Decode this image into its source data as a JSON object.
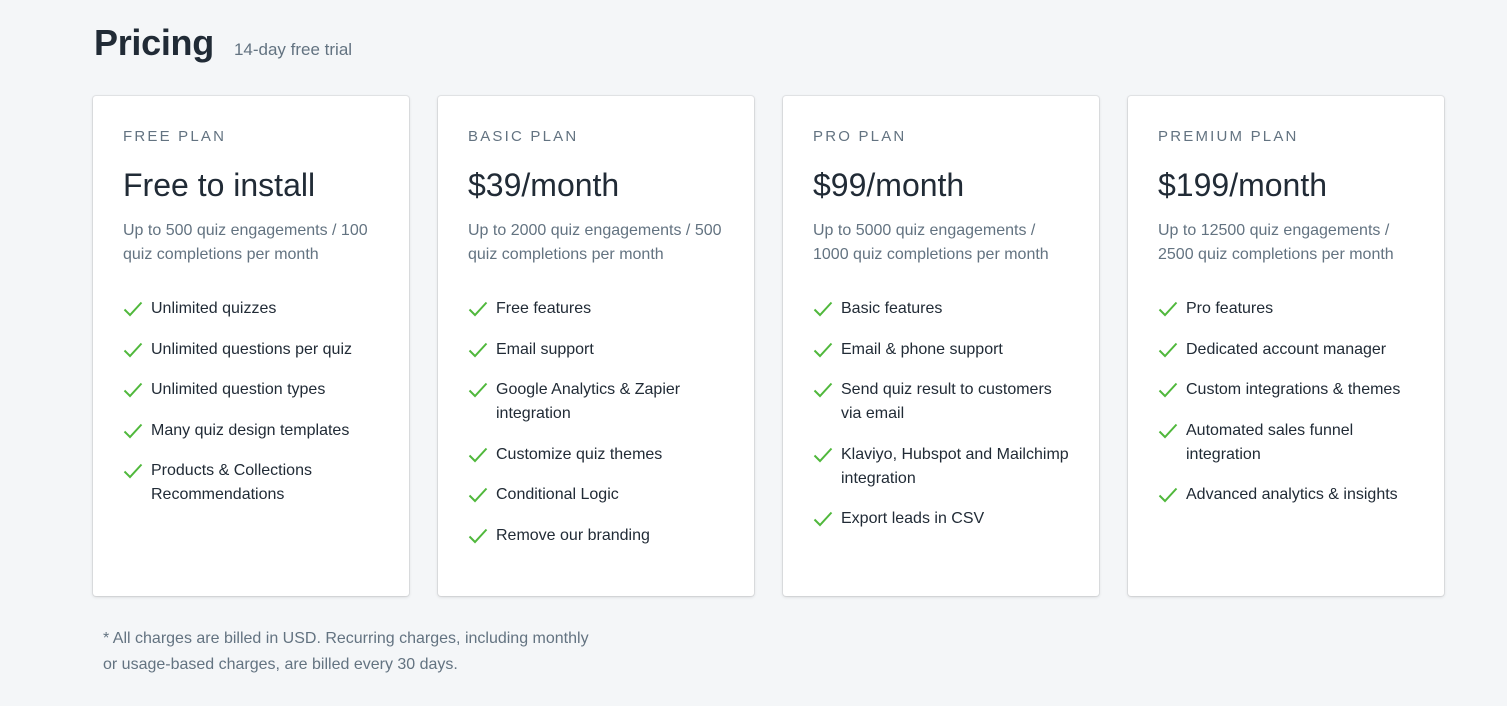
{
  "header": {
    "title": "Pricing",
    "subtitle": "14-day free trial"
  },
  "colors": {
    "check": "#50b83c",
    "background": "#f4f6f8",
    "text": "#212b36",
    "muted": "#637381"
  },
  "plans": [
    {
      "name": "FREE PLAN",
      "price": "Free to install",
      "description": "Up to 500 quiz engagements / 100 quiz completions per month",
      "features": [
        "Unlimited quizzes",
        "Unlimited questions per quiz",
        "Unlimited question types",
        "Many quiz design templates",
        "Products & Collections Recommendations"
      ]
    },
    {
      "name": "BASIC PLAN",
      "price": "$39/month",
      "description": "Up to 2000 quiz engagements / 500 quiz completions per month",
      "features": [
        "Free features",
        "Email support",
        "Google Analytics & Zapier integration",
        "Customize quiz themes",
        "Conditional Logic",
        "Remove our branding"
      ]
    },
    {
      "name": "PRO PLAN",
      "price": "$99/month",
      "description": "Up to 5000 quiz engagements / 1000 quiz completions per month",
      "features": [
        "Basic features",
        "Email & phone support",
        "Send quiz result to customers via email",
        "Klaviyo, Hubspot and Mailchimp integration",
        "Export leads in CSV"
      ]
    },
    {
      "name": "PREMIUM PLAN",
      "price": "$199/month",
      "description": "Up to 12500 quiz engagements / 2500 quiz completions per month",
      "features": [
        "Pro features",
        "Dedicated account manager",
        "Custom integrations & themes",
        "Automated sales funnel integration",
        "Advanced analytics & insights"
      ]
    }
  ],
  "footnote": "* All charges are billed in USD. Recurring charges, including monthly or usage-based charges, are billed every 30 days."
}
